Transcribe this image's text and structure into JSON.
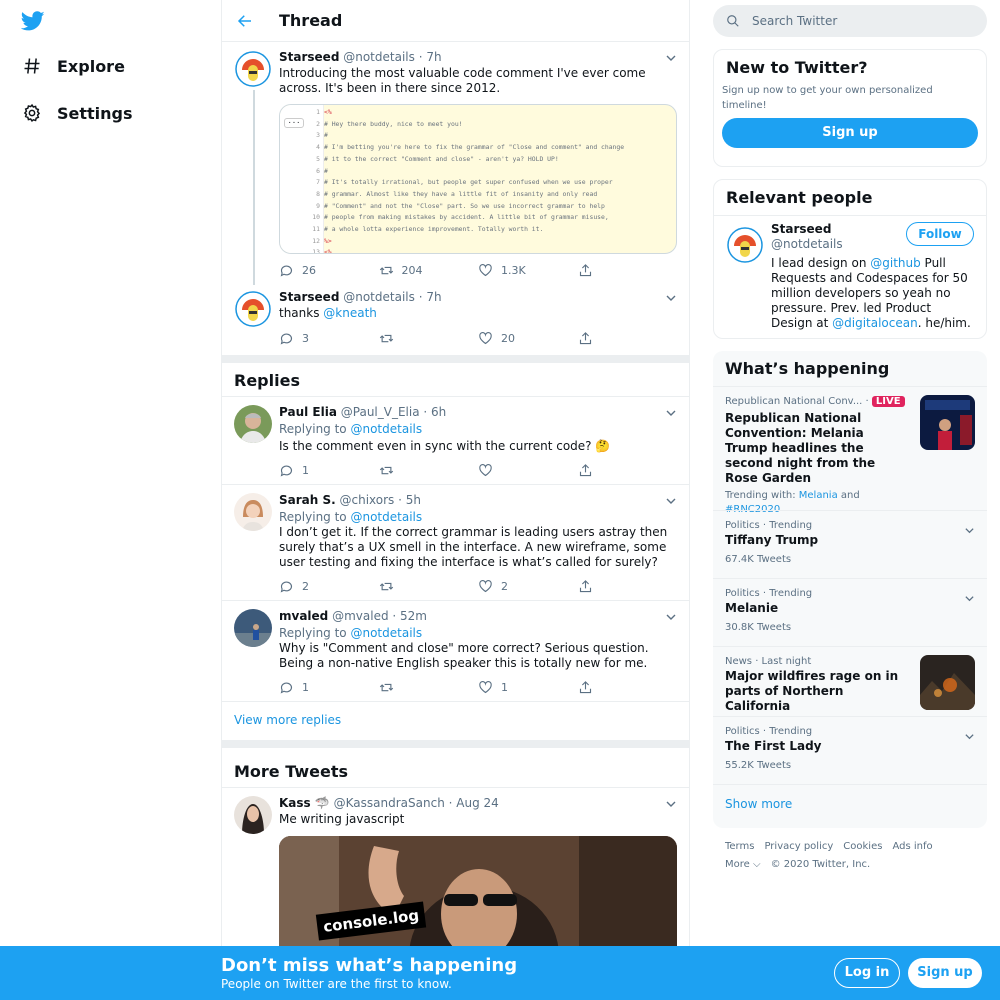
{
  "nav": {
    "explore": "Explore",
    "settings": "Settings"
  },
  "thread": {
    "title": "Thread",
    "tweets": [
      {
        "name": "Starseed",
        "handle": "@notdetails",
        "time": "· 7h",
        "text": "Introducing the most valuable code comment I've ever come across. It's been in there since 2012.",
        "replies": "26",
        "retweets": "204",
        "likes": "1.3K",
        "code_lines": [
          {
            "n": "1",
            "c": "<%"
          },
          {
            "n": "2",
            "c": "# Hey there buddy, nice to meet you!"
          },
          {
            "n": "3",
            "c": "#"
          },
          {
            "n": "4",
            "c": "# I'm betting you're here to fix the grammar of \"Close and comment\" and change"
          },
          {
            "n": "5",
            "c": "# it to the correct \"Comment and close\" - aren't ya? HOLD UP!"
          },
          {
            "n": "6",
            "c": "#"
          },
          {
            "n": "7",
            "c": "# It's totally irrational, but people get super confused when we use proper"
          },
          {
            "n": "8",
            "c": "# grammar. Almost like they have a little fit of insanity and only read"
          },
          {
            "n": "9",
            "c": "# \"Comment\" and not the \"Close\" part. So we use incorrect grammar to help"
          },
          {
            "n": "10",
            "c": "# people from making mistakes by accident. A little bit of grammar misuse,"
          },
          {
            "n": "11",
            "c": "# a whole lotta experience improvement. Totally worth it."
          },
          {
            "n": "12",
            "c": "%>"
          },
          {
            "n": "13",
            "c": "<%"
          }
        ],
        "code_dots": "···"
      },
      {
        "name": "Starseed",
        "handle": "@notdetails",
        "time": "· 7h",
        "text_prefix": "thanks ",
        "mention": "@kneath",
        "replies": "3",
        "retweets": "",
        "likes": "20"
      }
    ]
  },
  "replies": {
    "title": "Replies",
    "replying_to": "Replying to",
    "mention": "@notdetails",
    "items": [
      {
        "name": "Paul Elia",
        "handle": "@Paul_V_Elia",
        "time": "· 6h",
        "text": "Is the comment even in sync with the current code? 🤔",
        "replies": "1",
        "retweets": "",
        "likes": ""
      },
      {
        "name": "Sarah S.",
        "handle": "@chixors",
        "time": "· 5h",
        "text": "I don’t get it. If the correct grammar is leading users astray then surely that’s a UX smell in the interface. A new wireframe, some user testing and fixing the interface is what’s called for surely?",
        "replies": "2",
        "retweets": "",
        "likes": "2"
      },
      {
        "name": "mvaled",
        "handle": "@mvaled",
        "time": "· 52m",
        "text": "Why is \"Comment and close\" more correct? Serious question. Being a non-native English speaker this is totally new for me.",
        "replies": "1",
        "retweets": "",
        "likes": "1"
      }
    ],
    "view_more": "View more replies"
  },
  "more": {
    "title": "More Tweets",
    "tweet": {
      "name": "Kass 🦈",
      "handle": "@KassandraSanch",
      "time": "· Aug 24",
      "text": "Me writing javascript",
      "image_caption": "console.log"
    }
  },
  "right": {
    "search_placeholder": "Search Twitter",
    "new_to": {
      "title": "New to Twitter?",
      "body": "Sign up now to get your own personalized timeline!",
      "signup": "Sign up"
    },
    "relevant": {
      "title": "Relevant people",
      "name": "Starseed",
      "handle": "@notdetails",
      "follow": "Follow",
      "bio_1": "I lead design on ",
      "bio_m1": "@github",
      "bio_2": " Pull Requests and Codespaces for 50 million developers so yeah no pressure. Prev. led Product Design at ",
      "bio_m2": "@digitalocean",
      "bio_3": ". he/him."
    },
    "happening": {
      "title": "What’s happening",
      "live_badge": "LIVE",
      "trend1_meta": "Republican National Conv... ·",
      "trend1_name": "Republican National Convention: Melania Trump headlines the second night from the Rose Garden",
      "trend1_with": "Trending with: ",
      "trend1_tag1": "Melania",
      "trend1_and": " and",
      "trend1_tag2": "#RNC2020",
      "trends": [
        {
          "meta": "Politics · Trending",
          "name": "Tiffany Trump",
          "count": "67.4K Tweets"
        },
        {
          "meta": "Politics · Trending",
          "name": "Melanie",
          "count": "30.8K Tweets"
        }
      ],
      "news_meta": "News · Last night",
      "news_name": "Major wildfires rage on in parts of Northern California",
      "trend_last": {
        "meta": "Politics · Trending",
        "name": "The First Lady",
        "count": "55.2K Tweets"
      },
      "show_more": "Show more"
    },
    "footer": {
      "terms": "Terms",
      "privacy": "Privacy policy",
      "cookies": "Cookies",
      "ads": "Ads info",
      "more": "More ⌵",
      "copyright": "© 2020 Twitter, Inc."
    }
  },
  "bottombar": {
    "headline": "Don’t miss what’s happening",
    "sub": "People on Twitter are the first to know.",
    "login": "Log in",
    "signup": "Sign up"
  },
  "colors": {
    "brand": "#1da1f2",
    "link": "#1b95e0",
    "live": "#e0245e"
  }
}
